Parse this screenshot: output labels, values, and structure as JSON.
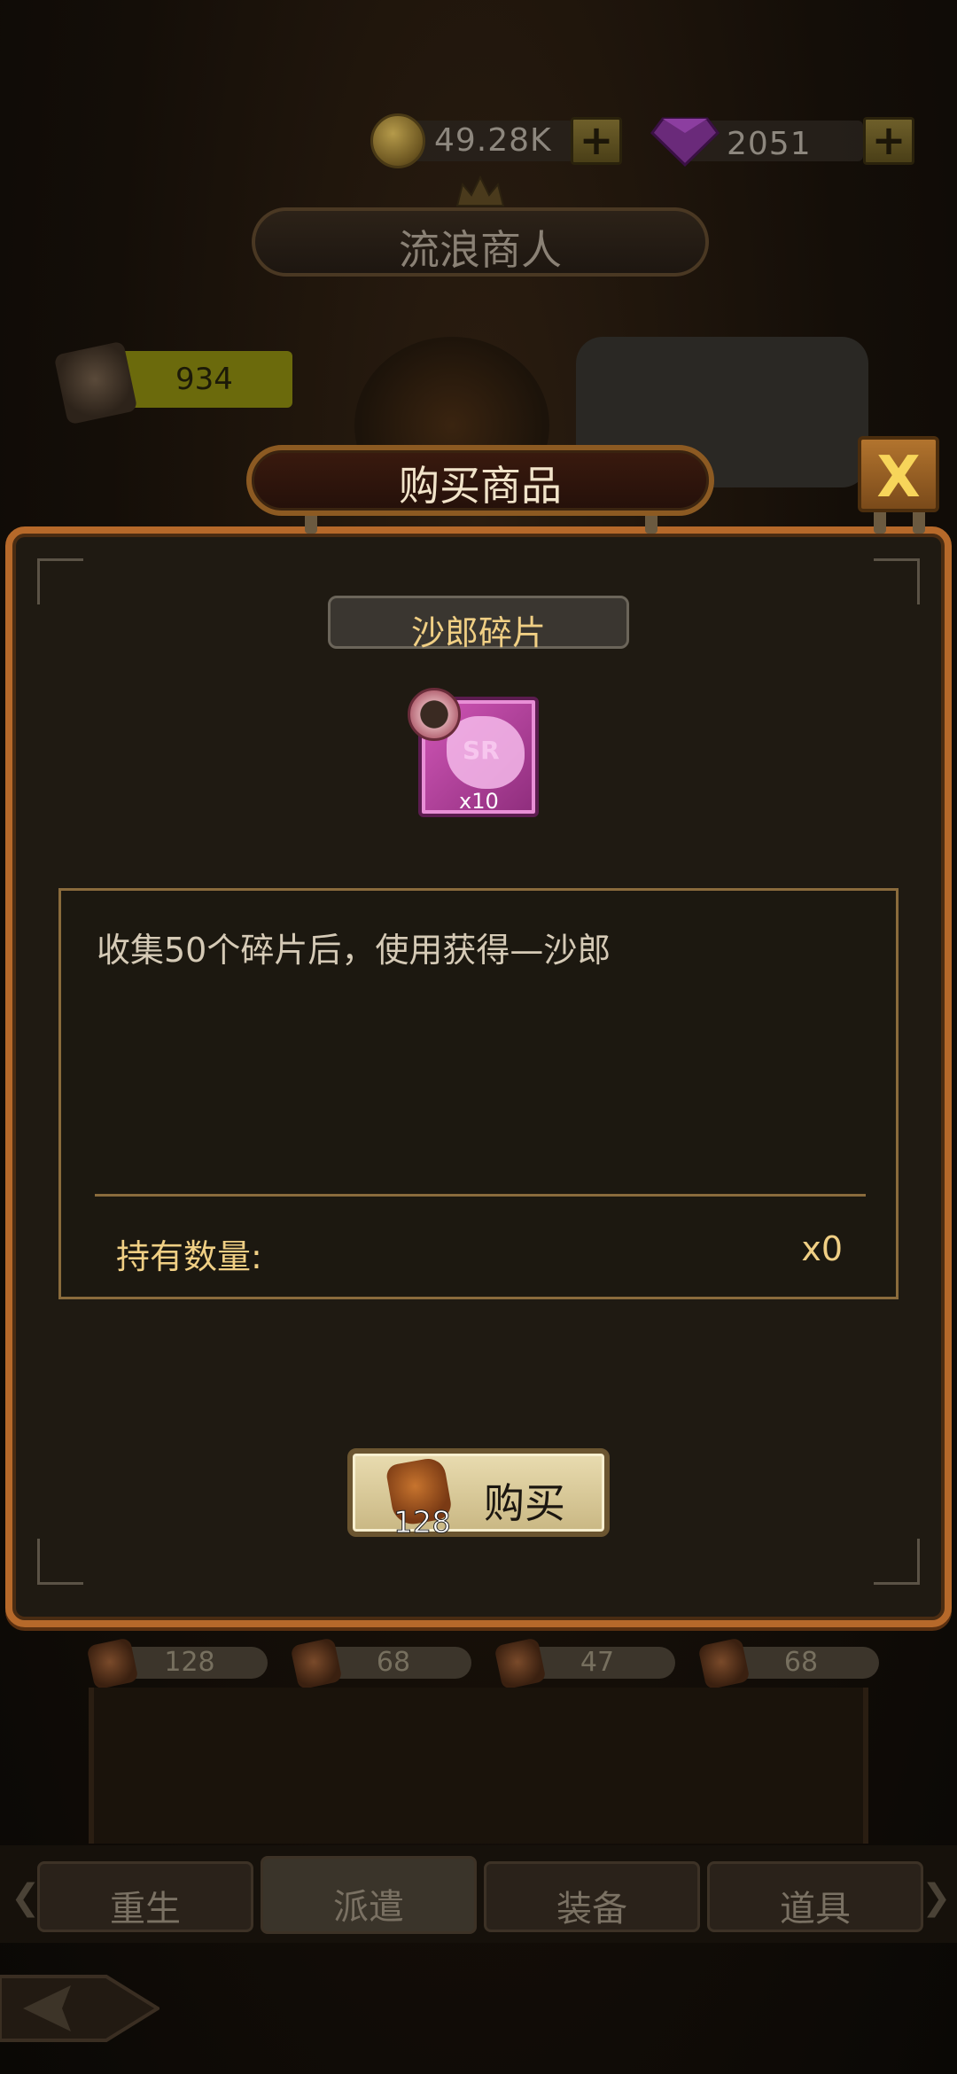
{
  "resources": {
    "coins": "49.28K",
    "gems": "2051",
    "plus_label": "+"
  },
  "merchant": {
    "title": "流浪商人"
  },
  "currency_chip": {
    "value": "934"
  },
  "dialog": {
    "title": "购买商品",
    "close_label": "X",
    "item": {
      "name": "沙郎碎片",
      "rarity": "SR",
      "count": "x10"
    },
    "description": "收集50个碎片后，使用获得—沙郎",
    "hold_label": "持有数量:",
    "hold_value": "x0",
    "buy": {
      "price": "128",
      "label": "购买"
    }
  },
  "shop_prices": [
    "128",
    "68",
    "47",
    "68"
  ],
  "tabs": [
    {
      "label": "重生",
      "active": false
    },
    {
      "label": "派遣",
      "active": true
    },
    {
      "label": "装备",
      "active": false
    },
    {
      "label": "道具",
      "active": false
    }
  ],
  "colors": {
    "panel_border": "#b6692a",
    "gold_text": "#f0cf84",
    "sr_pink": "#d257b8"
  }
}
